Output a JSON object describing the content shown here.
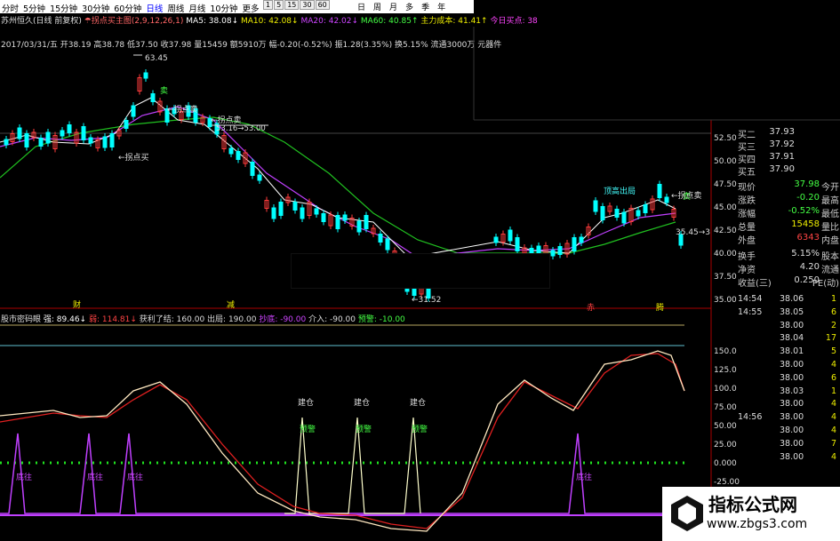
{
  "toolbar": {
    "periods": [
      "分时",
      "5分钟",
      "15分钟",
      "30分钟",
      "60分钟",
      "日线",
      "周线",
      "月线",
      "10分钟",
      "更多"
    ],
    "active_period": "日线",
    "zoom_buttons": [
      "1",
      "5",
      "15",
      "30",
      "60"
    ],
    "right_icons": [
      "日",
      "周",
      "月",
      "多",
      "季",
      "年"
    ]
  },
  "main_info": {
    "row1": {
      "stock": "苏州恒久(日线 前复权)",
      "indicator": "☂拐点买主图(2,9,12,26,1)",
      "ma5": "MA5: 38.08↓",
      "ma10": "MA10: 42.08↓",
      "ma20": "MA20: 42.02↓",
      "ma60": "MA60: 40.85↑",
      "cost": "主力成本: 41.41↑",
      "today": "今日买点: 38"
    },
    "row2": "2017/03/31/五 开38.19 高38.78 低37.50 收37.98 量15459 额5910万 幅-0.20(-0.52%) 振1.28(3.35%) 换5.15% 流通3000万 元器件"
  },
  "price_chart": {
    "annotations": {
      "high": "63.45",
      "buy_point": "←拐点买",
      "sell_point1": "←拐点卖",
      "sell_point2": "←拐点卖",
      "sell_label": "卖",
      "sell_label2": "卖",
      "mid_price": "53.16→53.00",
      "low": "←31.52",
      "top_out": "顶高出局",
      "end_price": "35.45→3"
    },
    "y_ticks": [
      "52.50",
      "50.00",
      "47.50",
      "45.00",
      "42.50",
      "40.00",
      "37.50",
      "35.00"
    ],
    "markers": [
      "财",
      "减",
      "赤",
      "腾"
    ]
  },
  "osc": {
    "title": "股市密码眼",
    "v1": "强: 89.46↓",
    "v2": "弱: 114.81↓",
    "v3": "获利了结: 160.00",
    "v4": "出局: 190.00",
    "v5": "抄底: -90.00",
    "v6": "介入: -90.00",
    "v7": "预警: -10.00",
    "y_ticks": [
      "150.0",
      "125.0",
      "100.0",
      "75.00",
      "50.00",
      "25.00",
      "0.000",
      "-25.00"
    ],
    "build": "建仓",
    "warn": "预警",
    "bottom": "底往"
  },
  "quote": {
    "rows": [
      {
        "label": "买二",
        "value": "37.93",
        "color": "#ddd"
      },
      {
        "label": "买三",
        "value": "37.92",
        "color": "#ddd"
      },
      {
        "label": "买四",
        "value": "37.91",
        "color": "#ddd"
      },
      {
        "label": "买五",
        "value": "37.90",
        "color": "#ddd"
      }
    ],
    "stats": [
      {
        "l1": "现价",
        "v1": "37.98",
        "l2": "今开",
        "c": "#4f4"
      },
      {
        "l1": "涨跌",
        "v1": "-0.20",
        "l2": "最高",
        "c": "#4f4"
      },
      {
        "l1": "涨幅",
        "v1": "-0.52%",
        "l2": "最低",
        "c": "#4f4"
      },
      {
        "l1": "总量",
        "v1": "15458",
        "l2": "量比",
        "c": "#ee0"
      },
      {
        "l1": "外盘",
        "v1": "6343",
        "l2": "内盘",
        "c": "#f44"
      },
      {
        "l1": "换手",
        "v1": "5.15%",
        "l2": "股本",
        "c": "#ddd"
      },
      {
        "l1": "净资",
        "v1": "4.20",
        "l2": "流通",
        "c": "#ddd"
      },
      {
        "l1": "收益(三)",
        "v1": "0.250",
        "l2": "PE(动)",
        "c": "#ddd"
      }
    ]
  },
  "ticks": [
    {
      "t": "14:54",
      "p": "38.06",
      "v": "1"
    },
    {
      "t": "14:55",
      "p": "38.05",
      "v": "6"
    },
    {
      "t": "",
      "p": "38.00",
      "v": "2"
    },
    {
      "t": "",
      "p": "38.04",
      "v": "17"
    },
    {
      "t": "",
      "p": "38.01",
      "v": "5"
    },
    {
      "t": "",
      "p": "38.00",
      "v": "4"
    },
    {
      "t": "",
      "p": "38.00",
      "v": "6"
    },
    {
      "t": "",
      "p": "38.03",
      "v": "1"
    },
    {
      "t": "",
      "p": "38.00",
      "v": "4"
    },
    {
      "t": "14:56",
      "p": "38.00",
      "v": "4"
    },
    {
      "t": "",
      "p": "38.00",
      "v": "4"
    },
    {
      "t": "",
      "p": "38.00",
      "v": "7"
    },
    {
      "t": "",
      "p": "38.00",
      "v": "4"
    }
  ],
  "watermark": {
    "cn": "指标公式网",
    "url": "www.zbgs3.com"
  },
  "colors": {
    "up": "#ff3b3b",
    "down": "#00ffff",
    "ma_white": "#ffffff",
    "ma_purple": "#c040ff",
    "ma_green": "#20c020"
  }
}
